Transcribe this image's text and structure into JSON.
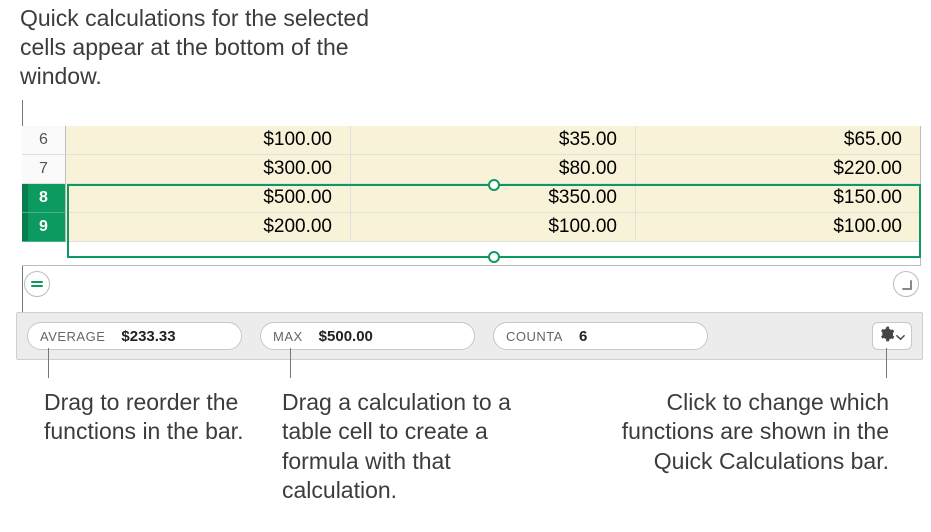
{
  "callouts": {
    "top": "Quick calculations for the selected cells appear at the bottom of the window.",
    "left": "Drag to reorder the functions in the bar.",
    "mid": "Drag a calculation to a table cell to create a formula with that calculation.",
    "right": "Click to change which functions are shown in the Quick Calculations bar."
  },
  "table": {
    "rows": [
      {
        "num": "6",
        "selected": false,
        "cells": [
          "$100.00",
          "$35.00",
          "$65.00"
        ]
      },
      {
        "num": "7",
        "selected": false,
        "cells": [
          "$300.00",
          "$80.00",
          "$220.00"
        ]
      },
      {
        "num": "8",
        "selected": true,
        "cells": [
          "$500.00",
          "$350.00",
          "$150.00"
        ]
      },
      {
        "num": "9",
        "selected": true,
        "cells": [
          "$200.00",
          "$100.00",
          "$100.00"
        ]
      }
    ]
  },
  "quickcalc": {
    "pills": [
      {
        "label": "AVERAGE",
        "value": "$233.33"
      },
      {
        "label": "MAX",
        "value": "$500.00"
      },
      {
        "label": "COUNTA",
        "value": "6"
      }
    ]
  }
}
